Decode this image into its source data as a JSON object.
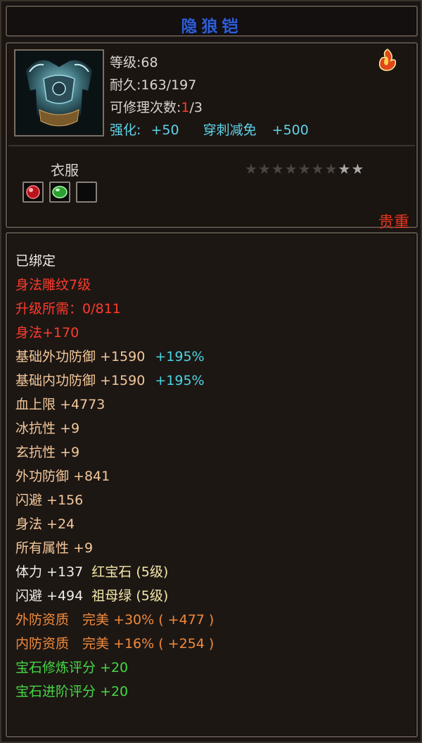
{
  "title": "隐狼铠",
  "info": {
    "level_label": "等级",
    "level_value": ":68",
    "durability_label": "耐久",
    "durability_value": ":163/197",
    "repair_label": "可修理次数",
    "repair_current": "1",
    "repair_total": "/3",
    "strengthen_label": "强化:",
    "strengthen_value": "+50",
    "pierce_label": "穿刺减免",
    "pierce_value": "+500",
    "item_type": "衣服",
    "rarity": "贵重",
    "stars_dim": "★★★★★★★",
    "stars_lit": "★★"
  },
  "attributes": {
    "bound": "已绑定",
    "engraving": "身法雕纹7级",
    "upgrade_need": "升级所需：0/811",
    "agility_bonus": "身法+170",
    "base_ext_def": "基础外功防御 +1590",
    "base_ext_def_pct": "+195%",
    "base_int_def": "基础内功防御 +1590",
    "base_int_def_pct": "+195%",
    "hp_max": "血上限 +4773",
    "ice_res": "冰抗性 +9",
    "xuan_res": "玄抗性 +9",
    "ext_def": "外功防御 +841",
    "dodge": "闪避 +156",
    "agility": "身法 +24",
    "all_attr": "所有属性 +9",
    "stamina": "体力 +137",
    "gem1": "红宝石 (5级)",
    "dodge2": "闪避 +494",
    "gem2": "祖母绿 (5级)",
    "ext_quality": "外防资质　完美 +30% ( +477 )",
    "int_quality": "内防资质　完美 +16% ( +254 )",
    "gem_refine": "宝石修炼评分 +20",
    "gem_advance": "宝石进阶评分 +20"
  },
  "colors": {
    "title": "#2e5fd6",
    "cyan": "#5fd3ea",
    "red": "#ff3a2c",
    "green": "#45d845",
    "orange": "#f28a3a"
  },
  "icons": {
    "item": "armor-icon",
    "corner": "flame-icon",
    "slot1": "red-gem-icon",
    "slot2": "green-gem-icon",
    "slot3": "empty-slot-icon"
  }
}
